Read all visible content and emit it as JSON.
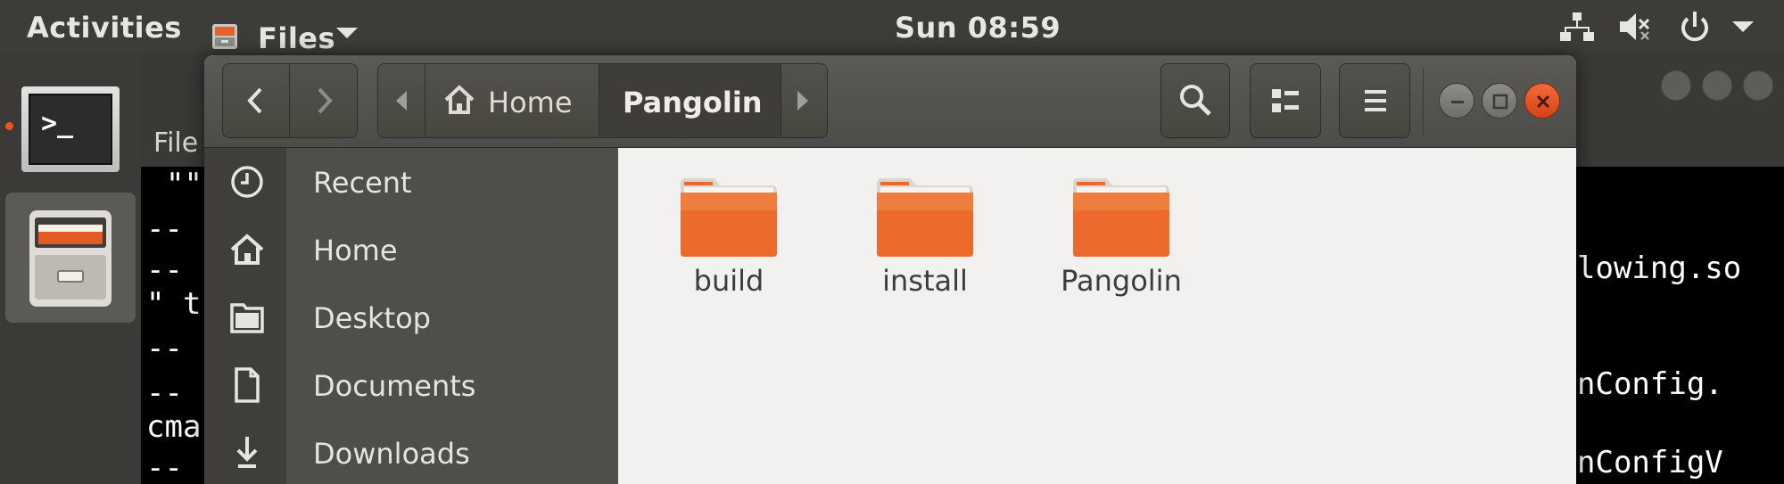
{
  "topbar": {
    "activities": "Activities",
    "app_menu_label": "Files",
    "clock": "Sun 08:59"
  },
  "dock": {
    "terminal_prompt": ">_",
    "items": [
      "terminal-icon",
      "files-icon"
    ]
  },
  "background_window": {
    "menu_file": "File",
    "terminal_lines": [
      "\"\"",
      "--",
      "--",
      "\" t",
      "--",
      "--",
      "cma",
      "--"
    ],
    "terminal_right_lines": [
      "lowing.so",
      "nConfig.",
      "nConfigV"
    ]
  },
  "nautilus": {
    "path": {
      "home_label": "Home",
      "current_label": "Pangolin"
    },
    "sidebar": {
      "items": [
        {
          "label": "Recent",
          "icon": "clock-icon"
        },
        {
          "label": "Home",
          "icon": "home-icon"
        },
        {
          "label": "Desktop",
          "icon": "desktop-folder-icon"
        },
        {
          "label": "Documents",
          "icon": "document-icon"
        },
        {
          "label": "Downloads",
          "icon": "download-icon"
        }
      ]
    },
    "folders": [
      {
        "name": "build"
      },
      {
        "name": "install"
      },
      {
        "name": "Pangolin"
      }
    ]
  },
  "colors": {
    "accent": "#e95420",
    "topbar_bg": "#3d3c39",
    "sidebar_bg": "#4f4e4a",
    "content_bg": "#f2f1f0",
    "folder_orange": "#ee6e2c"
  }
}
